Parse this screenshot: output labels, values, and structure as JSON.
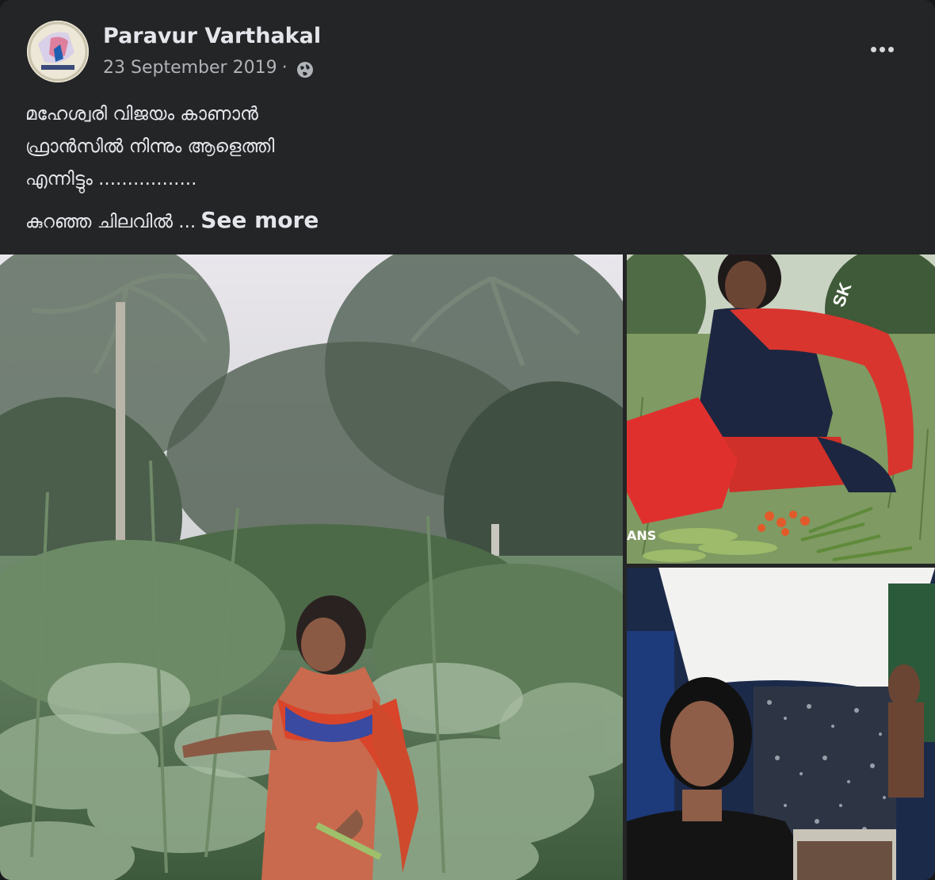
{
  "post": {
    "author": "Paravur Varthakal",
    "date": "23 September 2019",
    "separator": "·",
    "privacy_icon": "globe-icon",
    "more_icon": "more-options-icon",
    "text_lines": [
      "മഹേശ്വരി വിജയം കാണാൻ",
      "ഫ്രാൻസിൽ നിന്നും ആളെത്തി",
      "എന്നിട്ടും ................."
    ],
    "text_truncated": "കുറഞ്ഞ ചിലവിൽ ...",
    "see_more": "See more"
  },
  "photos": {
    "bag_text_1": "SK",
    "bag_text_2": "ANS"
  },
  "colors": {
    "background": "#18191a",
    "card": "#242526",
    "primary_text": "#e4e6eb",
    "secondary_text": "#b0b3b8"
  }
}
